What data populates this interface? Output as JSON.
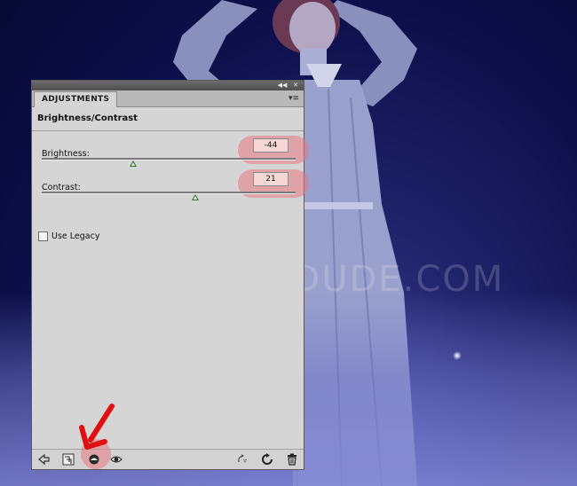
{
  "panel": {
    "tab_label": "ADJUSTMENTS",
    "menu_icon": "panel-menu-icon",
    "collapse_icon": "double-chevron-icon",
    "close_icon": "close-icon",
    "title": "Brightness/Contrast",
    "brightness": {
      "label": "Brightness:",
      "value": "-44",
      "slider_fraction": 0.36
    },
    "contrast": {
      "label": "Contrast:",
      "value": "21",
      "slider_fraction": 0.605
    },
    "legacy": {
      "label": "Use Legacy",
      "checked": false
    },
    "bottom_icons": [
      "back-arrow-icon",
      "clip-to-layer-icon",
      "view-previous-state-icon",
      "visibility-eye-icon",
      "reset-icon",
      "refresh-icon",
      "trash-icon"
    ]
  },
  "watermark": {
    "text": "WWW.PSD-DUDE.COM"
  },
  "colors": {
    "panel_bg": "#d5d5d5",
    "highlight": "#e87882",
    "slider_thumb": "#2c7a2c",
    "arrow": "#e01010"
  }
}
